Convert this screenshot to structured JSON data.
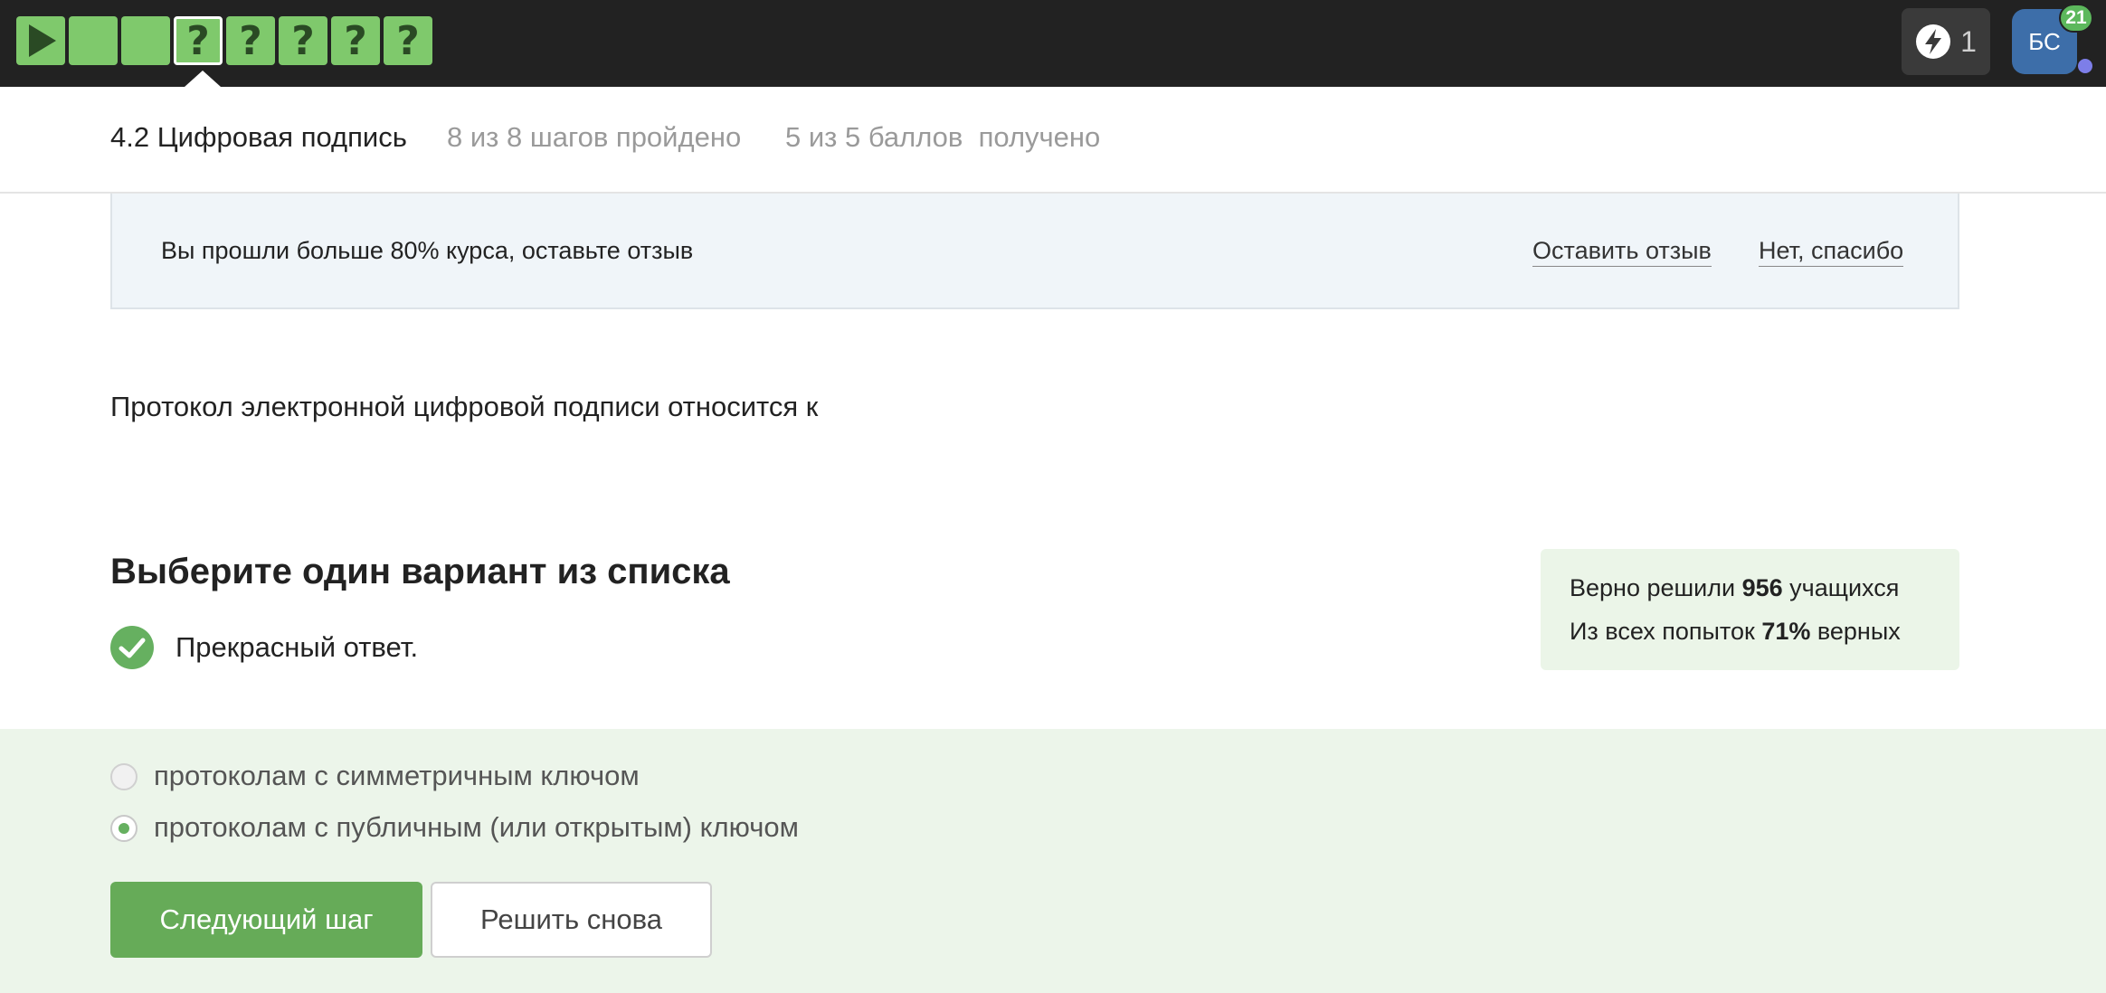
{
  "topbar": {
    "steps": [
      {
        "type": "video",
        "label": ""
      },
      {
        "type": "text",
        "label": ""
      },
      {
        "type": "text",
        "label": ""
      },
      {
        "type": "quiz",
        "label": "?",
        "current": true
      },
      {
        "type": "quiz",
        "label": "?"
      },
      {
        "type": "quiz",
        "label": "?"
      },
      {
        "type": "quiz",
        "label": "?"
      },
      {
        "type": "quiz",
        "label": "?"
      }
    ],
    "energy_count": "1",
    "avatar_initials": "БС",
    "notification_count": "21"
  },
  "lesson": {
    "title": "4.2 Цифровая подпись",
    "steps_progress": "8 из 8 шагов пройдено",
    "points_progress": "5 из 5 баллов  получено"
  },
  "review_banner": {
    "text": "Вы прошли больше 80% курса, оставьте отзыв",
    "leave_review": "Оставить отзыв",
    "no_thanks": "Нет, спасибо"
  },
  "question": {
    "text": "Протокол электронной цифровой подписи относится к",
    "choose_title": "Выберите один вариант из списка",
    "feedback": "Прекрасный ответ."
  },
  "stats": {
    "solved_prefix": "Верно решили ",
    "solved_count": "956",
    "solved_suffix": " учащихся",
    "attempts_prefix": "Из всех попыток ",
    "attempts_percent": "71%",
    "attempts_suffix": " верных"
  },
  "options": [
    {
      "label": "протоколам с симметричным ключом",
      "selected": false
    },
    {
      "label": "протоколам с публичным (или открытым) ключом",
      "selected": true
    }
  ],
  "buttons": {
    "next_step": "Следующий шаг",
    "retry": "Решить снова"
  },
  "colors": {
    "topbar": "#222222",
    "step_passed": "#7fc96c",
    "accent_green": "#66ab58",
    "answers_bg": "#ecf5ea",
    "avatar": "#3d6ea9"
  }
}
